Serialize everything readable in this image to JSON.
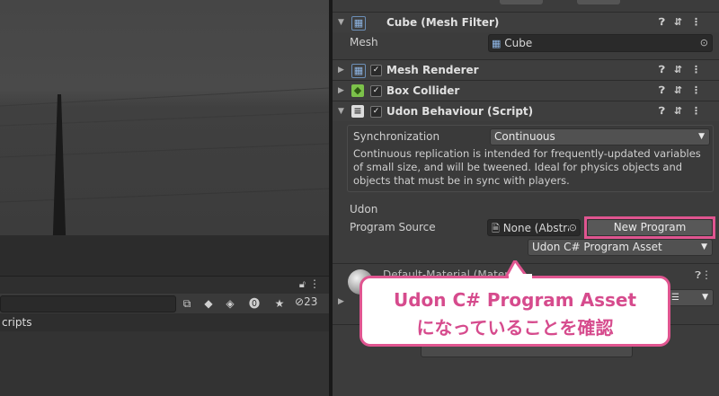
{
  "project": {
    "tab_label": "cripts",
    "hidden_count": "23"
  },
  "inspector": {
    "mesh_filter": {
      "title": "Cube (Mesh Filter)",
      "mesh_label": "Mesh",
      "mesh_value": "Cube"
    },
    "mesh_renderer": {
      "title": "Mesh Renderer"
    },
    "box_collider": {
      "title": "Box Collider"
    },
    "udon_behaviour": {
      "title": "Udon Behaviour (Script)",
      "sync_label": "Synchronization",
      "sync_value": "Continuous",
      "sync_help": "Continuous replication is intended for frequently-updated variables of small size, and will be tweened. Ideal for physics objects and objects that must be in sync with players.",
      "section_label": "Udon",
      "program_source_label": "Program Source",
      "program_source_value": "None (Abstra",
      "new_program_label": "New Program",
      "program_type_value": "Udon C# Program Asset"
    },
    "material": {
      "title": "Default-Material (Material)"
    }
  },
  "callout": {
    "line1": "Udon C# Program Asset",
    "line2": "になっていることを確認"
  },
  "colors": {
    "highlight": "#e05590",
    "callout_text": "#d64b8d"
  }
}
